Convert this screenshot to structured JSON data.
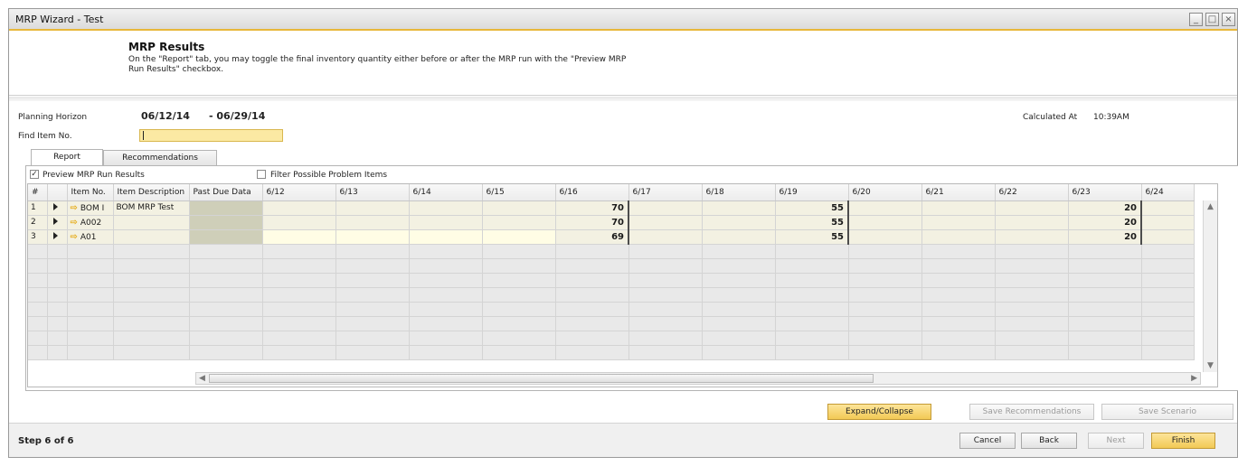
{
  "window": {
    "title": "MRP Wizard - Test",
    "controls": [
      "_",
      "□",
      "×"
    ]
  },
  "header": {
    "title": "MRP Results",
    "description": "On the \"Report\" tab, you may toggle the final inventory quantity either before or after the MRP run with the \"Preview MRP Run Results\" checkbox."
  },
  "planning": {
    "horizon_label": "Planning Horizon",
    "from_date": "06/12/14",
    "to_date": "- 06/29/14",
    "calculated_label": "Calculated At",
    "calculated_value": "10:39AM",
    "find_label": "Find Item No.",
    "find_value": ""
  },
  "tabs": [
    {
      "label": "Report",
      "active": true
    },
    {
      "label": "Recommendations",
      "active": false
    }
  ],
  "options": {
    "preview_label": "Preview MRP Run Results",
    "preview_checked": true,
    "filter_label": "Filter Possible Problem Items",
    "filter_checked": false
  },
  "grid": {
    "columns": [
      "#",
      "",
      "Item No.",
      "Item Description",
      "Past Due Data",
      "6/12",
      "6/13",
      "6/14",
      "6/15",
      "6/16",
      "6/17",
      "6/18",
      "6/19",
      "6/20",
      "6/21",
      "6/22",
      "6/23",
      "6/24"
    ],
    "rows": [
      {
        "num": "1",
        "item_no": "BOM I",
        "description": "BOM MRP Test",
        "cells": [
          "",
          "",
          "",
          "",
          "70",
          "",
          "",
          "55",
          "",
          "",
          "",
          "20",
          ""
        ]
      },
      {
        "num": "2",
        "item_no": "A002",
        "description": "",
        "cells": [
          "",
          "",
          "",
          "",
          "70",
          "",
          "",
          "55",
          "",
          "",
          "",
          "20",
          ""
        ]
      },
      {
        "num": "3",
        "item_no": "A01",
        "description": "",
        "cells": [
          "",
          "",
          "",
          "",
          "69",
          "",
          "",
          "55",
          "",
          "",
          "",
          "20",
          ""
        ]
      }
    ]
  },
  "buttons": {
    "expand": "Expand/Collapse",
    "save_recommendations": "Save Recommendations",
    "save_scenario": "Save Scenario",
    "cancel": "Cancel",
    "back": "Back",
    "next": "Next",
    "finish": "Finish"
  },
  "footer": {
    "step": "Step 6 of 6"
  }
}
